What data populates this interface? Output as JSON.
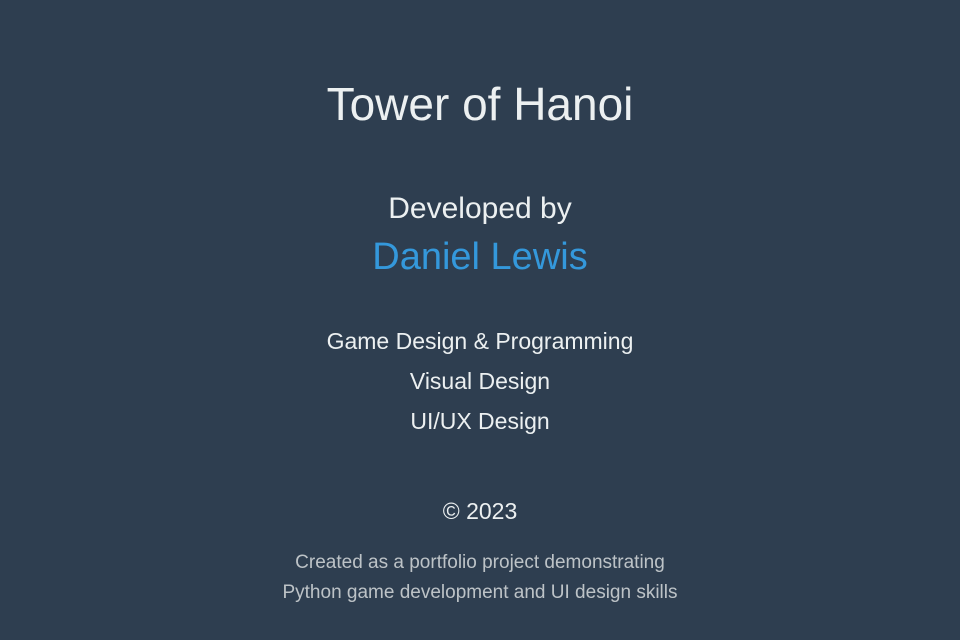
{
  "credits": {
    "title": "Tower of Hanoi",
    "developed_by_label": "Developed by",
    "developer_name": "Daniel Lewis",
    "roles": [
      "Game Design & Programming",
      "Visual Design",
      "UI/UX Design"
    ],
    "copyright": "© 2023",
    "description_lines": [
      "Created as a portfolio project demonstrating",
      "Python game development and UI design skills"
    ]
  },
  "colors": {
    "background": "#2e3e50",
    "text_primary": "#ecf0f1",
    "accent": "#3498db",
    "text_muted": "#bdc3c7"
  }
}
